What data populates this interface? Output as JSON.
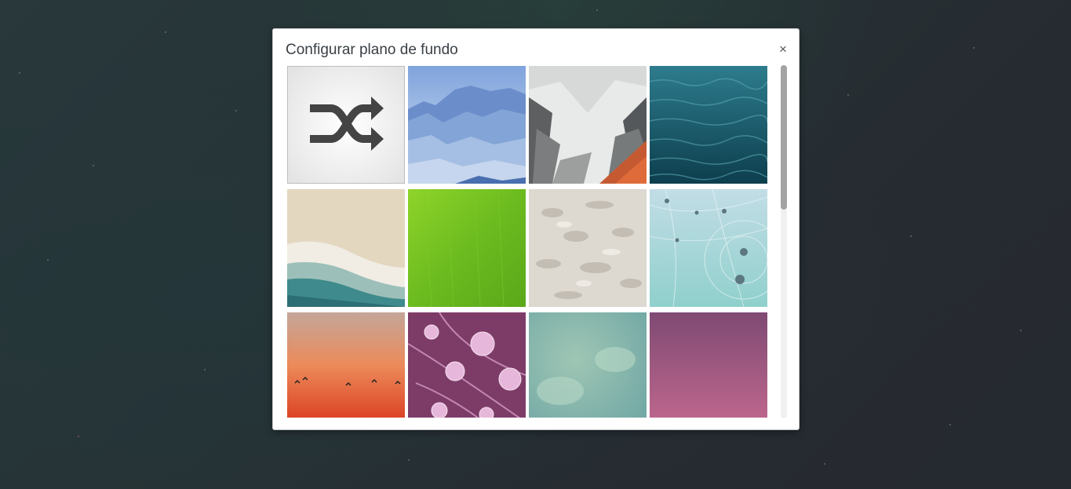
{
  "dialog": {
    "title": "Configurar plano de fundo",
    "close_label": "×"
  },
  "backgrounds": [
    {
      "name": "shuffle",
      "icon": "shuffle-icon"
    },
    {
      "name": "blue-mountains"
    },
    {
      "name": "snowy-valley"
    },
    {
      "name": "ocean-water"
    },
    {
      "name": "beach-waves"
    },
    {
      "name": "green-leaf"
    },
    {
      "name": "sand-texture"
    },
    {
      "name": "dew-web"
    },
    {
      "name": "sunset-birds"
    },
    {
      "name": "purple-leaf-drops"
    },
    {
      "name": "green-texture"
    },
    {
      "name": "purple-gradient"
    }
  ],
  "colors": {
    "accent": "#444444",
    "modal_bg": "#ffffff"
  }
}
